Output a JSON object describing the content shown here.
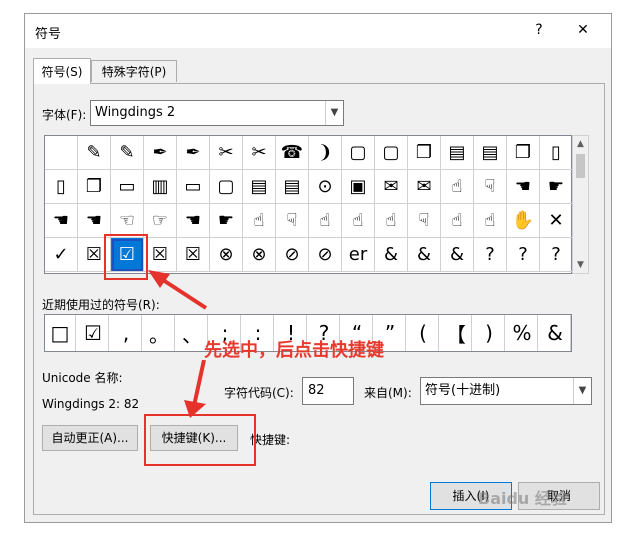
{
  "window": {
    "title": "符号",
    "help_label": "?",
    "close_label": "✕"
  },
  "tabs": [
    {
      "label": "符号(S)",
      "active": true
    },
    {
      "label": "特殊字符(P)",
      "active": false
    }
  ],
  "font": {
    "label": "字体(F):",
    "value": "Wingdings 2"
  },
  "symbols": {
    "rows": [
      [
        "",
        "✎",
        "✎",
        "✒",
        "✒",
        "✂",
        "✂",
        "☎",
        "❩",
        "▢",
        "▢",
        "❐",
        "▤",
        "▤",
        "❐",
        "▯"
      ],
      [
        "▯",
        "❐",
        "▭",
        "▥",
        "▭",
        "▢",
        "▤",
        "▤",
        "⊙",
        "▣",
        "✉",
        "✉",
        "☝",
        "☟",
        "☚",
        "☛"
      ],
      [
        "☚",
        "☚",
        "☜",
        "☞",
        "☚",
        "☛",
        "☝",
        "☟",
        "☝",
        "☝",
        "☝",
        "☟",
        "☝",
        "☝",
        "✋",
        "✕"
      ],
      [
        "✓",
        "☒",
        "☑",
        "☒",
        "☒",
        "⊗",
        "⊗",
        "⊘",
        "⊘",
        "er",
        "&",
        "&",
        "&",
        "?",
        "?",
        "?"
      ]
    ],
    "selected": {
      "row": 3,
      "col": 2
    }
  },
  "recent": {
    "label": "近期使用过的符号(R):",
    "items": [
      "□",
      "☑",
      ",",
      "。",
      "、",
      ";",
      ":",
      "!",
      "?",
      "“",
      "”",
      "(",
      "【",
      ")",
      "%",
      "&"
    ]
  },
  "unicode": {
    "name_label": "Unicode 名称:",
    "name_value": "Wingdings 2: 82",
    "char_code_label": "字符代码(C):",
    "char_code_value": "82",
    "from_label": "来自(M):",
    "from_value": "符号(十进制)"
  },
  "buttons": {
    "autocorrect": "自动更正(A)...",
    "shortcut": "快捷键(K)...",
    "shortcut_label": "快捷键:",
    "insert": "插入(I)",
    "cancel": "取消"
  },
  "annotation": {
    "text": "先选中，后点击快捷键"
  },
  "watermark": "Baidu 经验",
  "colors": {
    "accent": "#0078d7",
    "annotation": "#e8392f"
  }
}
